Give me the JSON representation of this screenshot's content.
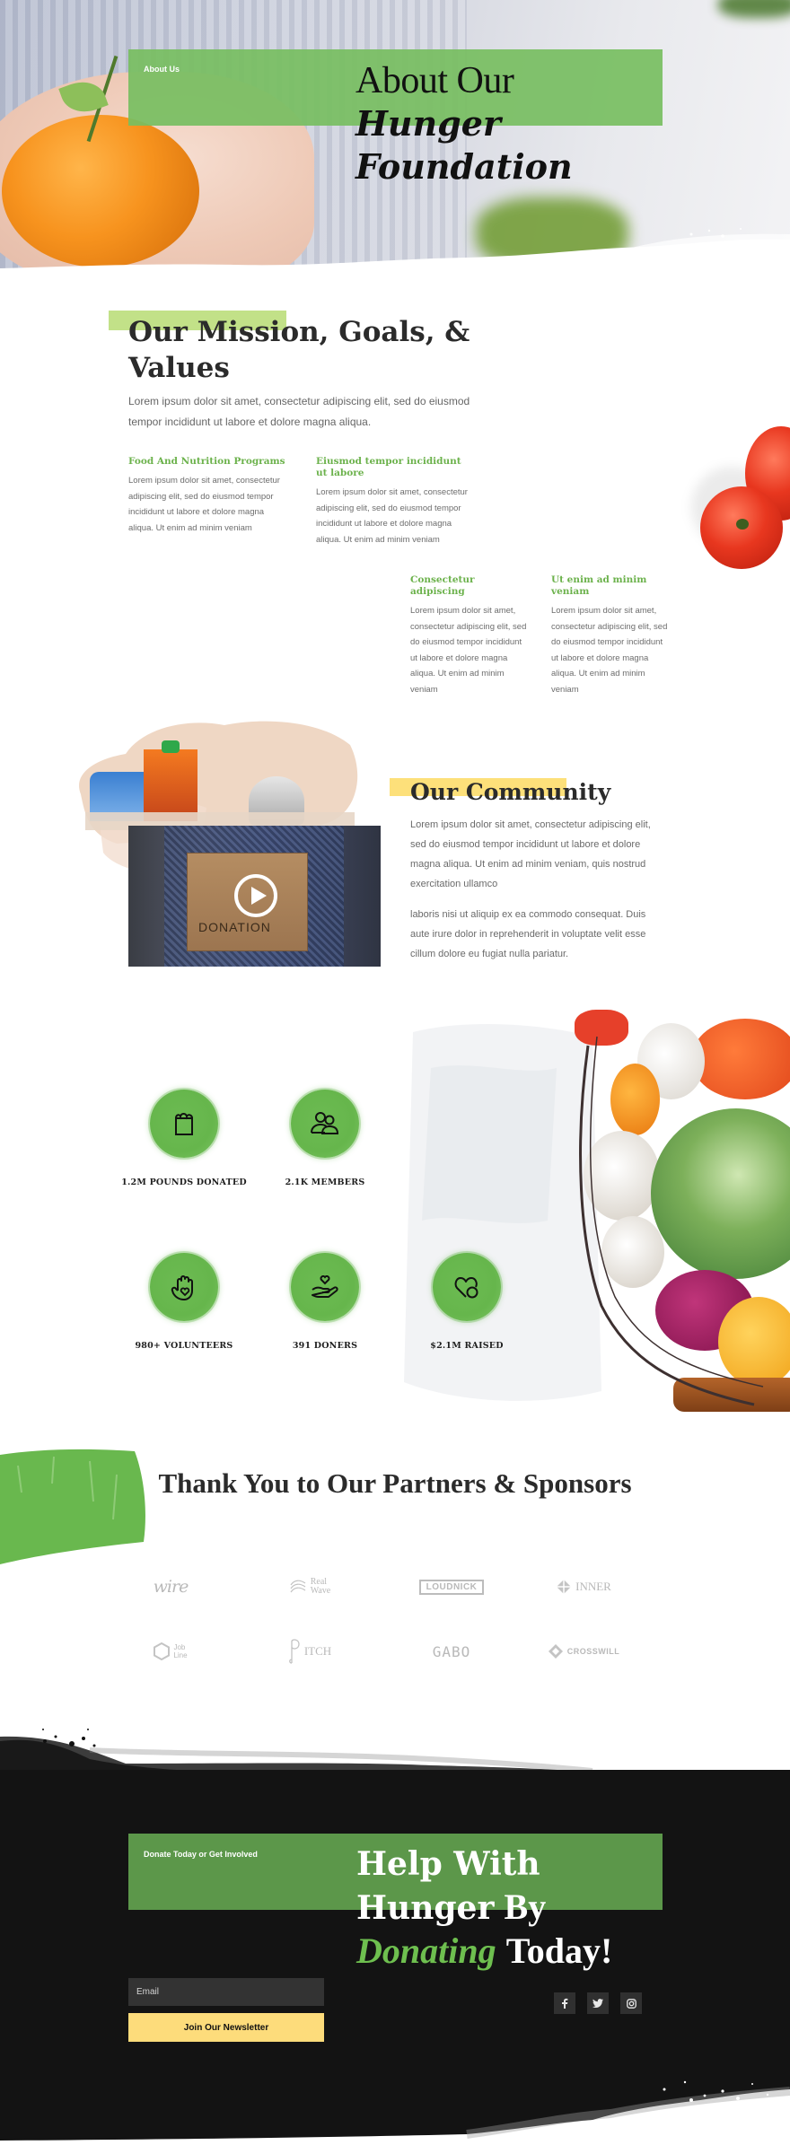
{
  "hero": {
    "eyebrow": "About Us",
    "title_line1": "About Our",
    "title_line2": "Hunger",
    "title_line3": "Foundation",
    "band_color": "#77be61"
  },
  "mission": {
    "title": "Our Mission, Goals, & Values",
    "lead": "Lorem ipsum dolor sit amet, consectetur adipiscing elit, sed do eiusmod tempor incididunt ut labore et dolore magna aliqua.",
    "highlight_color": "#c2e188",
    "pillars": [
      {
        "title": "Food And Nutrition Programs",
        "body": "Lorem ipsum dolor sit amet, consectetur adipiscing elit, sed do eiusmod tempor incididunt ut labore et dolore magna aliqua. Ut enim ad minim veniam"
      },
      {
        "title": "Eiusmod tempor incididunt ut labore",
        "body": "Lorem ipsum dolor sit amet, consectetur adipiscing elit, sed do eiusmod tempor incididunt ut labore et dolore magna aliqua. Ut enim ad minim veniam"
      },
      {
        "title": "Consectetur adipiscing",
        "body": "Lorem ipsum dolor sit amet, consectetur adipiscing elit, sed do eiusmod tempor incididunt ut labore et dolore magna aliqua. Ut enim ad minim veniam"
      },
      {
        "title": "Ut enim ad minim veniam",
        "body": "Lorem ipsum dolor sit amet, consectetur adipiscing elit, sed do eiusmod tempor incididunt ut labore et dolore magna aliqua. Ut enim ad minim veniam"
      }
    ]
  },
  "community": {
    "title": "Our Community",
    "highlight_color": "#fde07a",
    "p1": "Lorem ipsum dolor sit amet, consectetur adipiscing elit, sed do eiusmod tempor incididunt ut labore et dolore magna aliqua. Ut enim ad minim veniam, quis nostrud exercitation ullamco",
    "p2": "laboris nisi ut aliquip ex ea commodo consequat. Duis aute irure dolor in reprehenderit in voluptate velit esse cillum dolore eu fugiat nulla pariatur.",
    "video_box_label": "DONATION",
    "play_icon": "play-circle-icon"
  },
  "stats": [
    {
      "label": "1.2M POUNDS DONATED",
      "icon": "grocery-bag-icon"
    },
    {
      "label": "2.1K MEMBERS",
      "icon": "people-icon"
    },
    {
      "label": "980+ VOLUNTEERS",
      "icon": "hand-heart-icon"
    },
    {
      "label": "391 DONERS",
      "icon": "give-heart-icon"
    },
    {
      "label": "$2.1M RAISED",
      "icon": "heart-coin-icon"
    }
  ],
  "partners": {
    "title": "Thank You to Our Partners & Sponsors",
    "logos": [
      {
        "name": "wire",
        "text": "wire"
      },
      {
        "name": "realwave",
        "text": "Real\nWave"
      },
      {
        "name": "loudnick",
        "text": "LOUDNICK"
      },
      {
        "name": "inner",
        "text": "INNER"
      },
      {
        "name": "jobline",
        "text": "Job\nLine"
      },
      {
        "name": "pitch",
        "text": "ITCH"
      },
      {
        "name": "gabo",
        "text": "GABO"
      },
      {
        "name": "crosswill",
        "text": "CROSSWILL"
      }
    ]
  },
  "cta": {
    "eyebrow": "Donate Today or Get Involved",
    "title_part1": "Help With",
    "title_part2": "Hunger",
    "title_part3": "By",
    "title_part4": "Donating",
    "title_part5": "Today!",
    "band_color": "#5c974a",
    "accent_color": "#6ebf4f"
  },
  "newsletter": {
    "email_placeholder": "Email",
    "email_value": "",
    "button_label": "Join Our Newsletter",
    "button_color": "#fddc7b"
  },
  "social": [
    {
      "name": "facebook",
      "glyph": "f"
    },
    {
      "name": "twitter",
      "glyph": "t"
    },
    {
      "name": "instagram",
      "glyph": "ig"
    }
  ]
}
